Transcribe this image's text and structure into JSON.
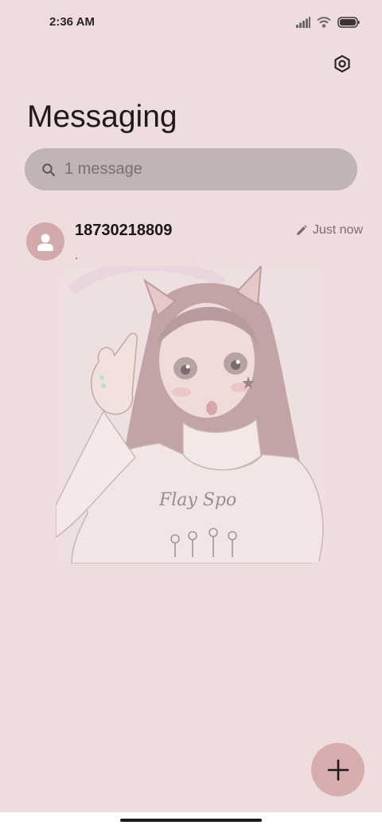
{
  "status_bar": {
    "time": "2:36 AM",
    "icons": [
      "signal-icon",
      "wifi-icon",
      "battery-icon"
    ]
  },
  "header": {
    "title": "Messaging",
    "settings_icon": "gear-icon"
  },
  "search": {
    "placeholder": "1 message",
    "icon": "search-icon"
  },
  "conversations": [
    {
      "contact": "18730218809",
      "timestamp": "Just now",
      "draft_icon": "pencil-icon",
      "snippet": ".",
      "avatar_icon": "person-icon",
      "has_image": true
    }
  ],
  "fab": {
    "icon": "plus-icon"
  },
  "colors": {
    "background": "#efdcdc",
    "search_bar": "#c1b4b5",
    "avatar": "#d2aaac",
    "fab": "#d7adb0",
    "text_primary": "#1f1a1a",
    "text_secondary": "#7a6e70"
  }
}
